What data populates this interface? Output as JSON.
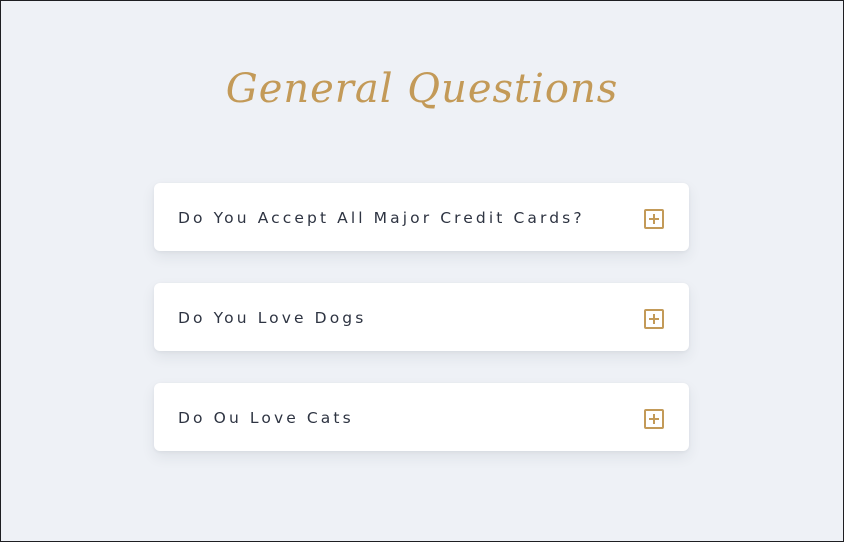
{
  "page": {
    "title": "General Questions",
    "accent_color": "#c39a58",
    "background_color": "#eef1f6"
  },
  "faq": {
    "items": [
      {
        "question": "Do You Accept All Major Credit Cards?",
        "icon": "plus-square-icon",
        "expanded": false
      },
      {
        "question": "Do You Love Dogs",
        "icon": "plus-square-icon",
        "expanded": false
      },
      {
        "question": "Do Ou Love Cats",
        "icon": "plus-square-icon",
        "expanded": false
      }
    ]
  }
}
